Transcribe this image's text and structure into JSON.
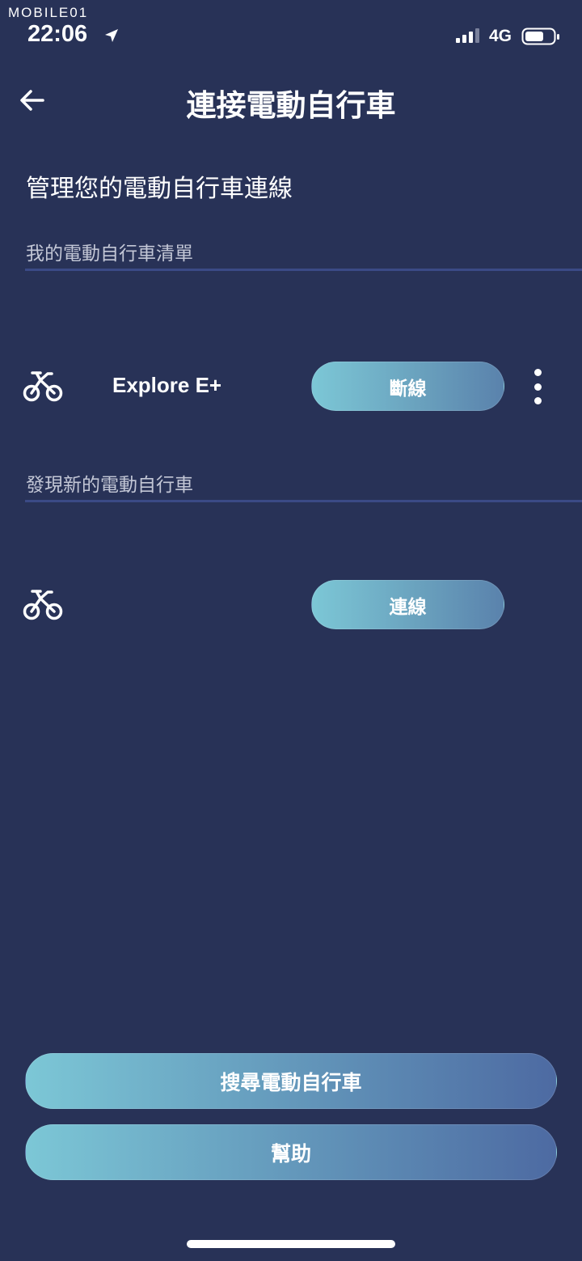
{
  "status_bar": {
    "watermark": "MOBILE01",
    "time": "22:06",
    "network": "4G"
  },
  "header": {
    "title": "連接電動自行車"
  },
  "section_title": "管理您的電動自行車連線",
  "my_bikes": {
    "label": "我的電動自行車清單",
    "items": [
      {
        "name": "Explore E+",
        "action_label": "斷線"
      }
    ]
  },
  "discover": {
    "label": "發現新的電動自行車",
    "items": [
      {
        "name": "",
        "action_label": "連線"
      }
    ]
  },
  "footer": {
    "search_label": "搜尋電動自行車",
    "help_label": "幫助"
  },
  "colors": {
    "background": "#283257",
    "divider": "#3b4a86",
    "button_gradient_start": "#7cc7d6",
    "button_gradient_end": "#4d6aa2"
  }
}
